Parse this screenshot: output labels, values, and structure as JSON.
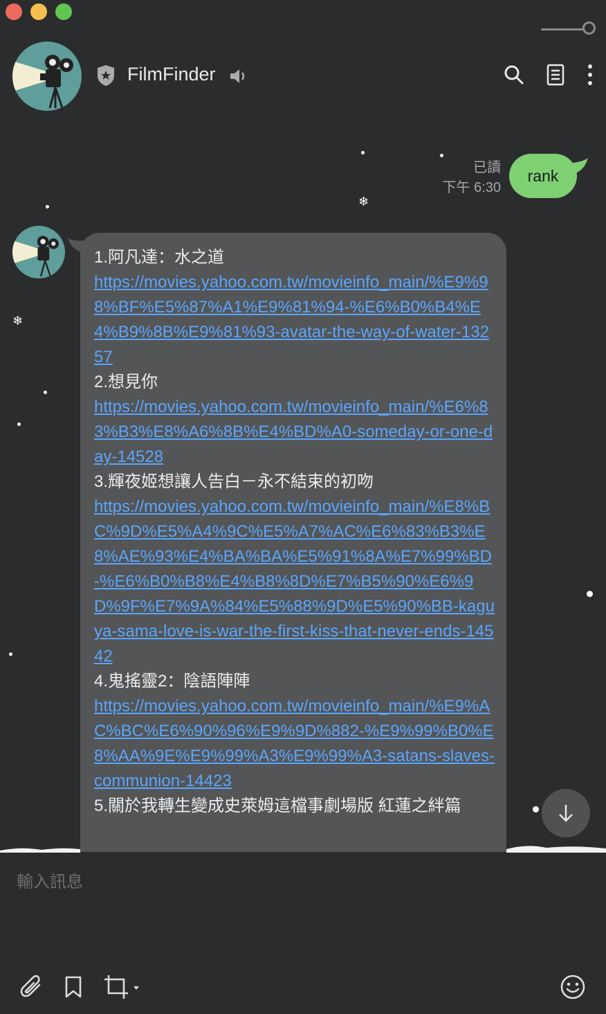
{
  "window": {
    "controls": [
      "close",
      "minimize",
      "zoom"
    ]
  },
  "header": {
    "title": "FilmFinder",
    "icons": [
      "shield-star-icon",
      "speaker-icon",
      "search-icon",
      "notes-icon",
      "more-icon"
    ]
  },
  "sent": {
    "read_label": "已讀",
    "time": "下午 6:30",
    "text": "rank"
  },
  "reply": {
    "lines": [
      {
        "kind": "text",
        "value": "1.阿凡達：水之道"
      },
      {
        "kind": "link",
        "value": "https://movies.yahoo.com.tw/movieinfo_main/%E9%98%BF%E5%87%A1%E9%81%94-%E6%B0%B4%E4%B9%8B%E9%81%93-avatar-the-way-of-water-13257"
      },
      {
        "kind": "text",
        "value": "2.想見你"
      },
      {
        "kind": "link",
        "value": "https://movies.yahoo.com.tw/movieinfo_main/%E6%83%B3%E8%A6%8B%E4%BD%A0-someday-or-one-day-14528"
      },
      {
        "kind": "text",
        "value": "3.輝夜姬想讓人告白－永不結束的初吻"
      },
      {
        "kind": "link",
        "value": "https://movies.yahoo.com.tw/movieinfo_main/%E8%BC%9D%E5%A4%9C%E5%A7%AC%E6%83%B3%E8%AE%93%E4%BA%BA%E5%91%8A%E7%99%BD-%E6%B0%B8%E4%B8%8D%E7%B5%90%E6%9D%9F%E7%9A%84%E5%88%9D%E5%90%BB-kaguya-sama-love-is-war-the-first-kiss-that-never-ends-14542"
      },
      {
        "kind": "text",
        "value": "4.鬼搖靈2：陰語陣陣"
      },
      {
        "kind": "link",
        "value": "https://movies.yahoo.com.tw/movieinfo_main/%E9%AC%BC%E6%90%96%E9%9D%882-%E9%99%B0%E8%AA%9E%E9%99%A3%E9%99%A3-satans-slaves-communion-14423"
      },
      {
        "kind": "text",
        "value": "5.關於我轉生變成史萊姆這檔事劇場版 紅蓮之絆篇"
      }
    ]
  },
  "composer": {
    "placeholder": "輸入訊息",
    "tools": [
      "attach-icon",
      "bookmark-icon",
      "crop-icon",
      "emoji-icon"
    ]
  }
}
